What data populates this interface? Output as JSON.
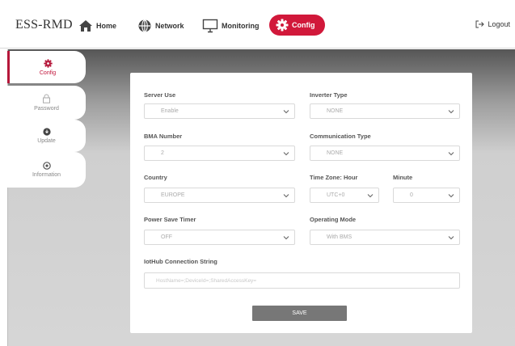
{
  "header": {
    "brand": "ESS-RMD",
    "nav": {
      "home": "Home",
      "network": "Network",
      "monitoring": "Monitoring",
      "config": "Config"
    },
    "logout": "Logout"
  },
  "sidebar": {
    "items": [
      {
        "label": "Config",
        "icon": "gear-icon",
        "active": true
      },
      {
        "label": "Password",
        "icon": "lock-icon",
        "active": false
      },
      {
        "label": "Update",
        "icon": "update-icon",
        "active": false
      },
      {
        "label": "Information",
        "icon": "info-icon",
        "active": false
      }
    ]
  },
  "form": {
    "server_use": {
      "label": "Server Use",
      "value": "Enable"
    },
    "inverter_type": {
      "label": "Inverter Type",
      "value": "NONE"
    },
    "bma_number": {
      "label": "BMA Number",
      "value": "2"
    },
    "communication_type": {
      "label": "Communication Type",
      "value": "NONE"
    },
    "country": {
      "label": "Country",
      "value": "EUROPE"
    },
    "timezone_hour": {
      "label": "Time Zone: Hour",
      "value": "UTC+0"
    },
    "minute": {
      "label": "Minute",
      "value": "0"
    },
    "power_save_timer": {
      "label": "Power Save Timer",
      "value": "OFF"
    },
    "operating_mode": {
      "label": "Operating Mode",
      "value": "With BMS"
    },
    "iothub": {
      "label": "IotHub Connection String",
      "placeholder": "HostName=;DeviceId=;SharedAccessKey="
    },
    "save_label": "SAVE"
  },
  "colors": {
    "accent": "#d1183a",
    "button": "#777777"
  }
}
